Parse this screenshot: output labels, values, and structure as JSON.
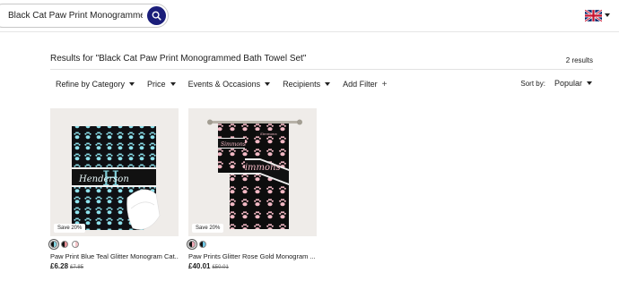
{
  "search": {
    "value": "Black Cat Paw Print Monogrammed Bath"
  },
  "header": {
    "flag": "uk-flag-icon"
  },
  "results": {
    "prefix": "Results for ",
    "query": "\"Black Cat Paw Print Monogrammed Bath Towel Set\"",
    "count": "2 results"
  },
  "filters": [
    {
      "label": "Refine by Category",
      "kind": "dropdown"
    },
    {
      "label": "Price",
      "kind": "dropdown"
    },
    {
      "label": "Events & Occasions",
      "kind": "dropdown"
    },
    {
      "label": "Recipients",
      "kind": "dropdown"
    },
    {
      "label": "Add Filter",
      "kind": "add"
    }
  ],
  "sort": {
    "label": "Sort by:",
    "value": "Popular"
  },
  "products": [
    {
      "badge": "Save 20%",
      "title": "Paw Print Blue Teal Glitter Monogram Cat...",
      "price": "£6.28",
      "old_price": "£7.85",
      "monogram_name": "Henderson",
      "monogram_letter": "H",
      "swatches": [
        "#7fd3e0",
        "#e58f95",
        "#f5c4c8"
      ]
    },
    {
      "badge": "Save 20%",
      "title": "Paw Prints Glitter Rose Gold Monogram ...",
      "price": "£40.01",
      "old_price": "£50.01",
      "monogram_name": "Simmons",
      "swatches": [
        "#f0a8b5",
        "#6dc8e6"
      ]
    }
  ],
  "colors": {
    "search_button": "#1b1e7a",
    "teal_paw": "#8ee3ee",
    "pink_paw": "#f2b8c4",
    "towel_black": "#101010"
  }
}
